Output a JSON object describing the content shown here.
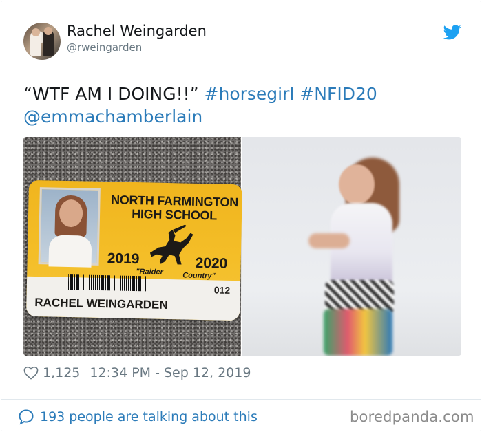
{
  "user": {
    "display_name": "Rachel Weingarden",
    "handle": "@rweingarden"
  },
  "tweet": {
    "quote": "“WTF AM I DOING!!”",
    "hashtags": [
      "#horsegirl",
      "#NFID20"
    ],
    "mention": "@emmachamberlain"
  },
  "id_card": {
    "school_line1": "NORTH FARMINGTON",
    "school_line2": "HIGH SCHOOL",
    "year_start": "2019",
    "year_end": "2020",
    "motto_left": "\"Raider",
    "motto_right": "Country\"",
    "id_number": "012",
    "student_name": "RACHEL WEINGARDEN"
  },
  "meta": {
    "likes": "1,125",
    "timestamp": "12:34 PM - Sep 12, 2019"
  },
  "footer": {
    "talking": "193 people are talking about this",
    "watermark": "boredpanda.com"
  },
  "colors": {
    "link": "#2b7bb9",
    "twitter_blue": "#1da1f2",
    "muted": "#697882",
    "card_yellow": "#f4be28"
  },
  "icons": {
    "brand": "twitter-bird-icon",
    "like": "heart-icon",
    "reply": "speech-bubble-icon"
  }
}
